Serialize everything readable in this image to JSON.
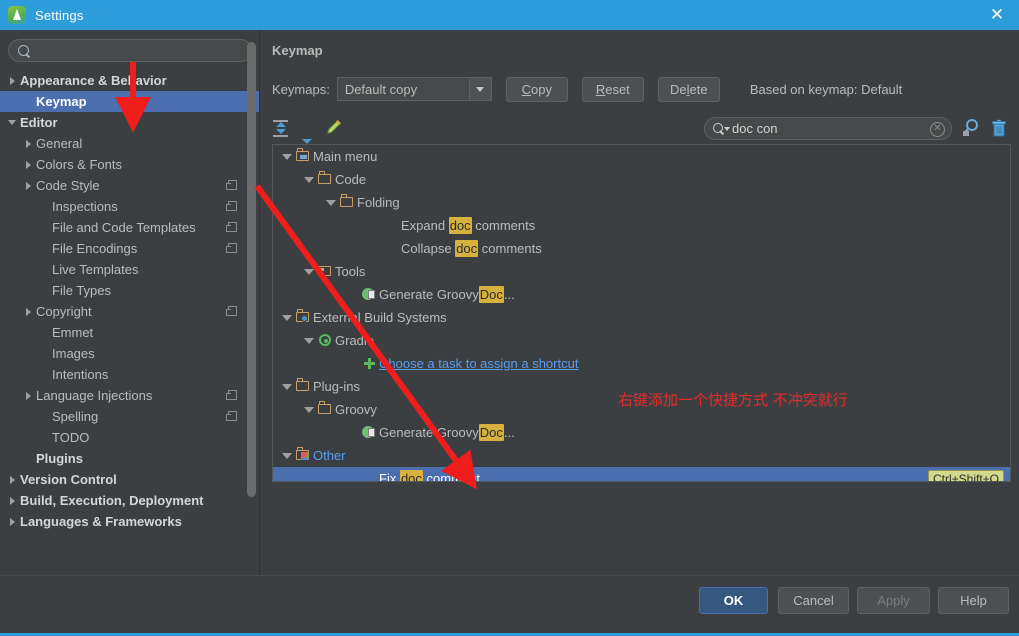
{
  "window": {
    "title": "Settings",
    "app_icon": "android-studio-icon",
    "close_label": "✕",
    "titlebar_color": "#2d9cdb"
  },
  "sidebar": {
    "search_placeholder": "",
    "search_value": "",
    "search_icon": "search-icon",
    "items": [
      {
        "label": "Appearance & Behavior",
        "indent": 0,
        "arrow": "closed",
        "bold": true,
        "selected": false,
        "badge": false
      },
      {
        "label": "Keymap",
        "indent": 1,
        "arrow": "none",
        "bold": true,
        "selected": true,
        "badge": false
      },
      {
        "label": "Editor",
        "indent": 0,
        "arrow": "open",
        "bold": true,
        "selected": false,
        "badge": false
      },
      {
        "label": "General",
        "indent": 1,
        "arrow": "closed",
        "bold": false,
        "selected": false,
        "badge": false
      },
      {
        "label": "Colors & Fonts",
        "indent": 1,
        "arrow": "closed",
        "bold": false,
        "selected": false,
        "badge": false
      },
      {
        "label": "Code Style",
        "indent": 1,
        "arrow": "closed",
        "bold": false,
        "selected": false,
        "badge": true
      },
      {
        "label": "Inspections",
        "indent": 2,
        "arrow": "none",
        "bold": false,
        "selected": false,
        "badge": true
      },
      {
        "label": "File and Code Templates",
        "indent": 2,
        "arrow": "none",
        "bold": false,
        "selected": false,
        "badge": true
      },
      {
        "label": "File Encodings",
        "indent": 2,
        "arrow": "none",
        "bold": false,
        "selected": false,
        "badge": true
      },
      {
        "label": "Live Templates",
        "indent": 2,
        "arrow": "none",
        "bold": false,
        "selected": false,
        "badge": false
      },
      {
        "label": "File Types",
        "indent": 2,
        "arrow": "none",
        "bold": false,
        "selected": false,
        "badge": false
      },
      {
        "label": "Copyright",
        "indent": 1,
        "arrow": "closed",
        "bold": false,
        "selected": false,
        "badge": true
      },
      {
        "label": "Emmet",
        "indent": 2,
        "arrow": "none",
        "bold": false,
        "selected": false,
        "badge": false
      },
      {
        "label": "Images",
        "indent": 2,
        "arrow": "none",
        "bold": false,
        "selected": false,
        "badge": false
      },
      {
        "label": "Intentions",
        "indent": 2,
        "arrow": "none",
        "bold": false,
        "selected": false,
        "badge": false
      },
      {
        "label": "Language Injections",
        "indent": 1,
        "arrow": "closed",
        "bold": false,
        "selected": false,
        "badge": true
      },
      {
        "label": "Spelling",
        "indent": 2,
        "arrow": "none",
        "bold": false,
        "selected": false,
        "badge": true
      },
      {
        "label": "TODO",
        "indent": 2,
        "arrow": "none",
        "bold": false,
        "selected": false,
        "badge": false
      },
      {
        "label": "Plugins",
        "indent": 1,
        "arrow": "none",
        "bold": true,
        "selected": false,
        "badge": false
      },
      {
        "label": "Version Control",
        "indent": 0,
        "arrow": "closed",
        "bold": true,
        "selected": false,
        "badge": false
      },
      {
        "label": "Build, Execution, Deployment",
        "indent": 0,
        "arrow": "closed",
        "bold": true,
        "selected": false,
        "badge": false
      },
      {
        "label": "Languages & Frameworks",
        "indent": 0,
        "arrow": "closed",
        "bold": true,
        "selected": false,
        "badge": false
      }
    ]
  },
  "content": {
    "panel_title": "Keymap",
    "keymaps_label": "Keymaps:",
    "keymap_selected": "Default copy",
    "buttons": {
      "copy": {
        "pre": "",
        "mnemonic": "C",
        "post": "opy"
      },
      "reset": {
        "pre": "",
        "mnemonic": "R",
        "post": "eset"
      },
      "delete": {
        "pre": "De",
        "mnemonic": "l",
        "post": "ete"
      }
    },
    "based_on": "Based on keymap: Default",
    "toolbar": {
      "expand_all": "expand-all-icon",
      "collapse_all": "collapse-all-icon",
      "edit_shortcut": "pencil-icon",
      "filter": "filter-by-shortcut-icon",
      "clear_all": "trash-icon"
    },
    "search": {
      "value": "doc con",
      "icon": "search-icon",
      "clear_icon": "clear-icon"
    },
    "annotation_note": "右键添加一个快捷方式 不冲突就行",
    "annotation_color": "#e02b2b",
    "tree": [
      {
        "id": "main-menu",
        "label": "Main menu",
        "indent": 0,
        "twisty": "open",
        "icon": "folder-menu",
        "selected": false
      },
      {
        "id": "code",
        "label": "Code",
        "indent": 1,
        "twisty": "open",
        "icon": "folder",
        "selected": false
      },
      {
        "id": "folding",
        "label": "Folding",
        "indent": 2,
        "twisty": "open",
        "icon": "folder",
        "selected": false
      },
      {
        "id": "expand-doc",
        "label_pre": "Expand ",
        "label_hl": "doc",
        "label_post": " comments",
        "indent": 4,
        "twisty": "none",
        "icon": "none",
        "selected": false
      },
      {
        "id": "collapse-doc",
        "label_pre": "Collapse ",
        "label_hl": "doc",
        "label_post": " comments",
        "indent": 4,
        "twisty": "none",
        "icon": "none",
        "selected": false
      },
      {
        "id": "tools",
        "label": "Tools",
        "indent": 1,
        "twisty": "open",
        "icon": "folder-square",
        "selected": false
      },
      {
        "id": "gen-groovydoc-1",
        "label_pre": "Generate Groovy",
        "label_hl": "Doc",
        "label_post": "...",
        "indent": 3,
        "twisty": "none",
        "icon": "groovy",
        "selected": false
      },
      {
        "id": "external-build",
        "label": "External Build Systems",
        "indent": 0,
        "twisty": "open",
        "icon": "folder-gear",
        "selected": false
      },
      {
        "id": "gradle",
        "label": "Gradle",
        "indent": 1,
        "twisty": "open",
        "icon": "gradle",
        "selected": false
      },
      {
        "id": "choose-task",
        "label": "Choose a task to assign a shortcut",
        "indent": 3,
        "twisty": "none",
        "icon": "plus",
        "link": true,
        "selected": false
      },
      {
        "id": "plug-ins",
        "label": "Plug-ins",
        "indent": 0,
        "twisty": "open",
        "icon": "folder",
        "selected": false
      },
      {
        "id": "groovy",
        "label": "Groovy",
        "indent": 1,
        "twisty": "open",
        "icon": "folder",
        "selected": false
      },
      {
        "id": "gen-groovydoc-2",
        "label_pre": "Generate Groovy",
        "label_hl": "Doc",
        "label_post": "...",
        "indent": 3,
        "twisty": "none",
        "icon": "groovy",
        "selected": false
      },
      {
        "id": "other",
        "label": "Other",
        "indent": 0,
        "twisty": "open",
        "icon": "folder-other",
        "blue": true,
        "selected": false
      },
      {
        "id": "fix-doc-comment",
        "label_pre": "Fix ",
        "label_hl": "doc",
        "label_post": " comment",
        "indent": 3,
        "twisty": "none",
        "icon": "none",
        "selected": true,
        "shortcut": "Ctrl+Shift+Q"
      }
    ]
  },
  "footer": {
    "ok": "OK",
    "cancel": "Cancel",
    "apply": "Apply",
    "help": "Help",
    "apply_disabled": true
  }
}
